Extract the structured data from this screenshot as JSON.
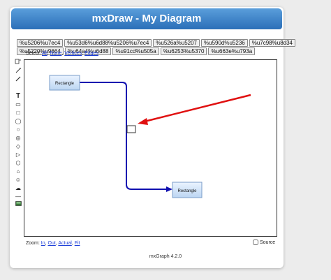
{
  "window": {
    "title": "mxDraw - My Diagram"
  },
  "toolbar_row1": [
    "%u5206%u7ec4",
    "%u53d6%u6d88%u5206%u7ec4",
    "%u526a%u5207",
    "%u590d%u5236",
    "%u7c98%u8d34"
  ],
  "toolbar_row2": [
    "%u5220%u9664",
    "%u64a4%u6d88",
    "%u91cd%u505a",
    "%u6253%u5370",
    "%u663e%u793a"
  ],
  "select": {
    "label": "Select:",
    "links": [
      "All",
      "None",
      "Vertices",
      "Edges"
    ]
  },
  "tools": [
    {
      "icon": "connect-icon"
    },
    {
      "icon": "line-icon"
    },
    {
      "icon": "diagonal-line-icon"
    },
    {
      "icon": "text-icon",
      "glyph": "T"
    },
    {
      "icon": "rectangle-icon",
      "glyph": "▭"
    },
    {
      "icon": "square-icon",
      "glyph": "□"
    },
    {
      "icon": "ellipse-icon",
      "glyph": "◯"
    },
    {
      "icon": "circle-icon",
      "glyph": "○"
    },
    {
      "icon": "double-ellipse-icon",
      "glyph": "◎"
    },
    {
      "icon": "rhombus-icon",
      "glyph": "◇"
    },
    {
      "icon": "triangle-icon",
      "glyph": "▷"
    },
    {
      "icon": "hexagon-icon",
      "glyph": "⬡"
    },
    {
      "icon": "cylinder-icon",
      "glyph": "⌂"
    },
    {
      "icon": "actor-icon",
      "glyph": "☺"
    },
    {
      "icon": "cloud-icon",
      "glyph": "☁"
    },
    {
      "icon": "hline-icon",
      "glyph": "—"
    },
    {
      "icon": "image-icon",
      "glyph": "▬"
    }
  ],
  "diagram": {
    "vertices": [
      {
        "label": "Rectangle"
      },
      {
        "label": "Rectangle"
      },
      {
        "label": ""
      }
    ],
    "edge_color": "#1010b0",
    "arrow_color": "#e01010"
  },
  "zoom": {
    "label": "Zoom:",
    "links": [
      "In",
      "Out",
      "Actual",
      "Fit"
    ]
  },
  "source": {
    "label": "Source",
    "checked": false
  },
  "footer": {
    "text": "mxGraph 4.2.0"
  }
}
